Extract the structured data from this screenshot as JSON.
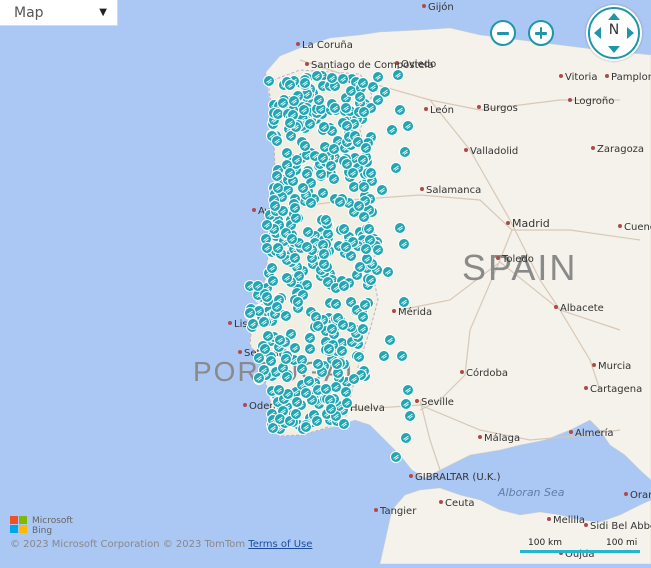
{
  "map_style": {
    "label": "Map",
    "caret": "▼"
  },
  "zoom": {
    "out_label": "Zoom out",
    "in_label": "Zoom in"
  },
  "compass": {
    "label": "N"
  },
  "countries": [
    {
      "text": "SPAIN"
    },
    {
      "text": "PORTUGAL"
    }
  ],
  "sea_label": "Alboran Sea",
  "cities": [
    {
      "name": "Gijón"
    },
    {
      "name": "Oviedo"
    },
    {
      "name": "Vitoria"
    },
    {
      "name": "Pamplona"
    },
    {
      "name": "La Coruña"
    },
    {
      "name": "Santiago de Compostela"
    },
    {
      "name": "León"
    },
    {
      "name": "Burgos"
    },
    {
      "name": "Logroño"
    },
    {
      "name": "Valladolid"
    },
    {
      "name": "Zaragoza"
    },
    {
      "name": "Salamanca"
    },
    {
      "name": "Aveiro"
    },
    {
      "name": "Madrid"
    },
    {
      "name": "Toledo"
    },
    {
      "name": "Cuenca"
    },
    {
      "name": "Lisbon"
    },
    {
      "name": "Mérida"
    },
    {
      "name": "Albacete"
    },
    {
      "name": "Setúbal"
    },
    {
      "name": "Córdoba"
    },
    {
      "name": "Murcia"
    },
    {
      "name": "Cartagena"
    },
    {
      "name": "Odemira"
    },
    {
      "name": "Huelva"
    },
    {
      "name": "Seville"
    },
    {
      "name": "Málaga"
    },
    {
      "name": "Almería"
    },
    {
      "name": "GIBRALTAR (U.K.)"
    },
    {
      "name": "Ceuta"
    },
    {
      "name": "Tangier"
    },
    {
      "name": "Melilla"
    },
    {
      "name": "Sidi Bel Abbès"
    },
    {
      "name": "Oran"
    },
    {
      "name": "Oujda"
    }
  ],
  "pin_color": "#22a6b3",
  "logo": {
    "line1": "Microsoft",
    "line2": "Bing"
  },
  "copyright": {
    "text": "© 2023 Microsoft Corporation  © 2023 TomTom",
    "link": "Terms of Use"
  },
  "scale": {
    "km": "100 km",
    "mi": "100 mi"
  }
}
